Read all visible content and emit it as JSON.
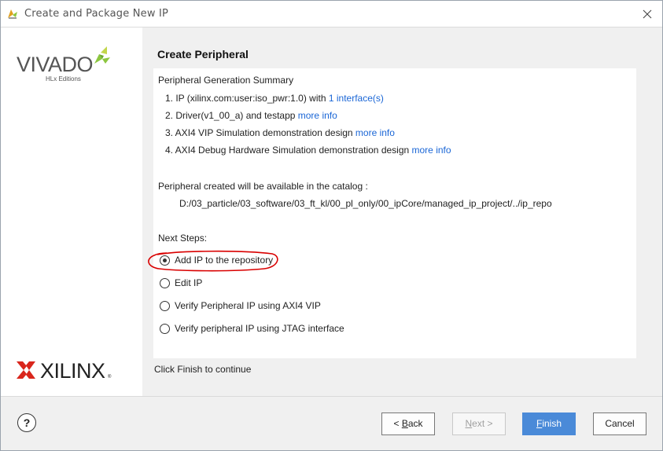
{
  "window": {
    "title": "Create and Package New IP"
  },
  "branding": {
    "vivado_word": "VIVADO",
    "vivado_sub": "HLx Editions",
    "xilinx_word": "XILINX",
    "xilinx_reg": "®"
  },
  "page": {
    "title": "Create Peripheral",
    "summary_heading": "Peripheral Generation Summary",
    "items": [
      {
        "text": "1. IP (xilinx.com:user:iso_pwr:1.0) with ",
        "link": "1 interface(s)"
      },
      {
        "text": "2. Driver(v1_00_a) and testapp ",
        "link": "more info"
      },
      {
        "text": "3. AXI4 VIP Simulation demonstration design ",
        "link": "more info"
      },
      {
        "text": "4. AXI4 Debug Hardware Simulation demonstration design ",
        "link": "more info"
      }
    ],
    "catalog_text": "Peripheral created will be available in the catalog :",
    "catalog_path": "D:/03_particle/03_software/03_ft_kl/00_pl_only/00_ipCore/managed_ip_project/../ip_repo",
    "next_steps_label": "Next Steps:",
    "options": [
      {
        "label": "Add IP to the repository",
        "checked": true
      },
      {
        "label": "Edit IP",
        "checked": false
      },
      {
        "label": "Verify Peripheral IP using AXI4 VIP",
        "checked": false
      },
      {
        "label": "Verify peripheral IP using JTAG interface",
        "checked": false
      }
    ],
    "footer_text": "Click Finish to continue"
  },
  "buttons": {
    "help": "?",
    "back_prefix": "< ",
    "back_mnemonic": "B",
    "back_rest": "ack",
    "next_mnemonic": "N",
    "next_rest": "ext >",
    "finish_mnemonic": "F",
    "finish_rest": "inish",
    "cancel": "Cancel"
  },
  "colors": {
    "link": "#1a66d6",
    "primary_button": "#4a8ad8",
    "annotation": "#d90000",
    "leaf_green": "#8cc63f",
    "xilinx_red": "#d9261c"
  }
}
